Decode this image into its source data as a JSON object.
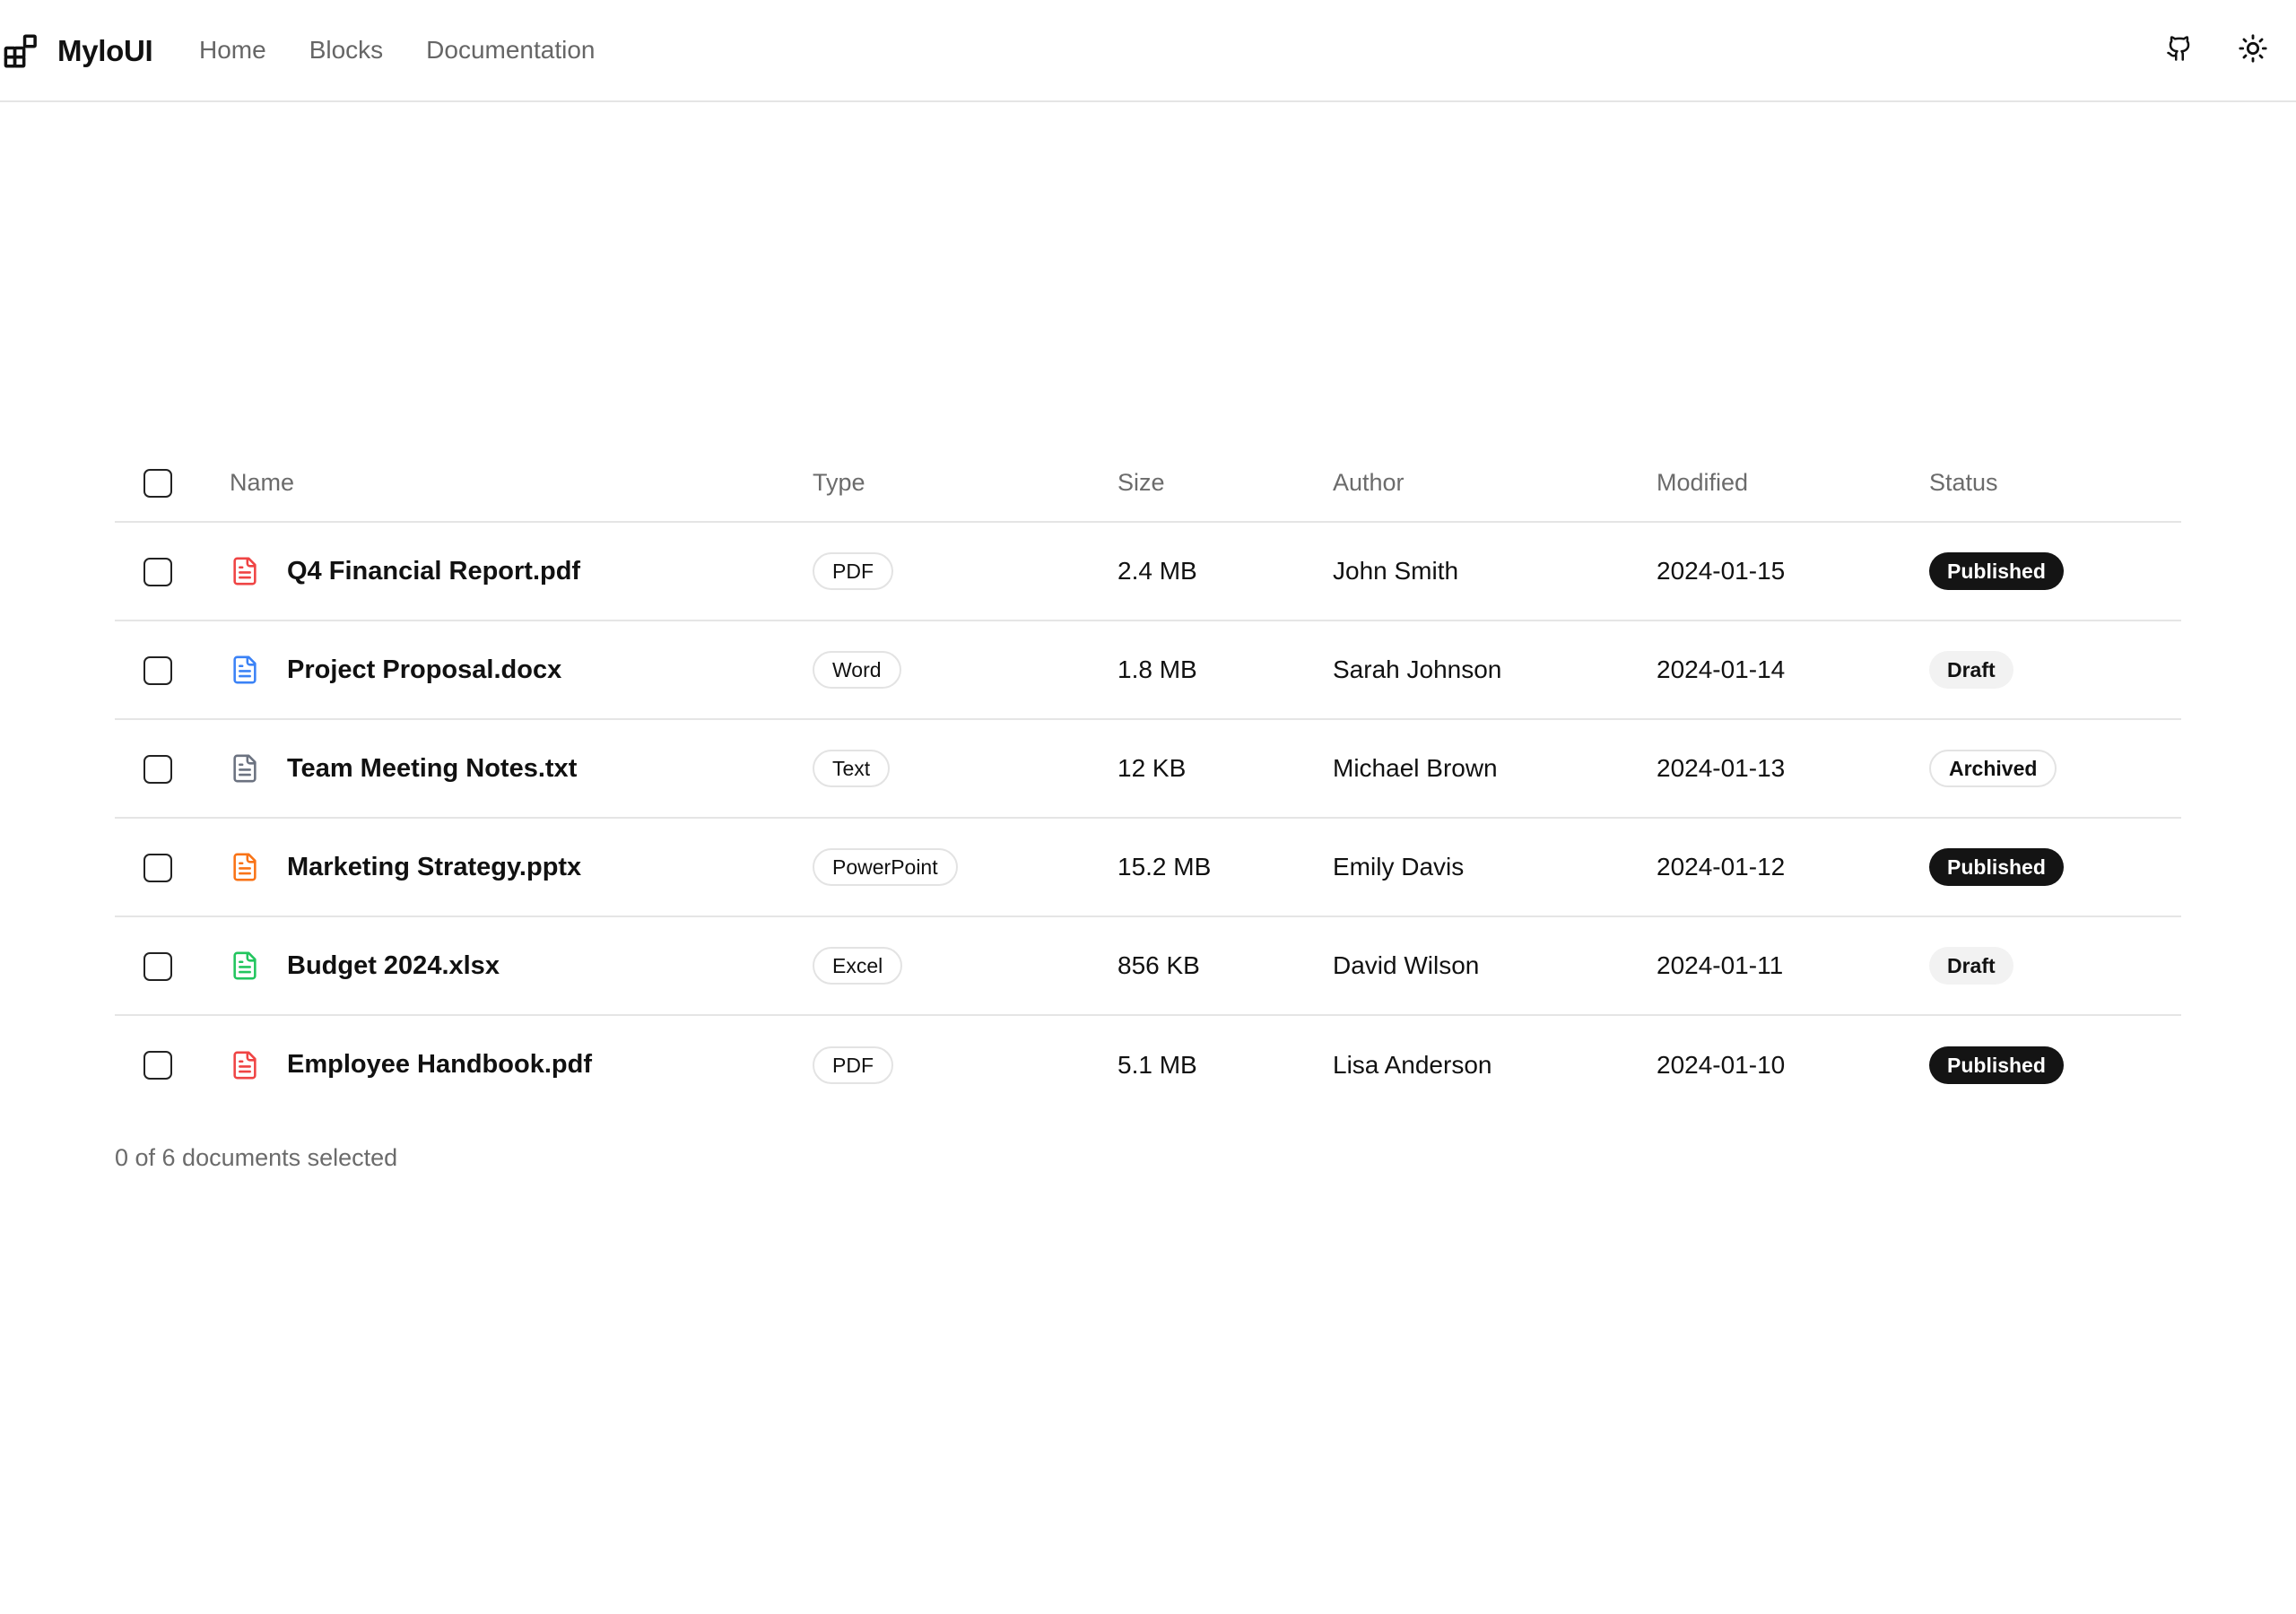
{
  "header": {
    "brand": "MyloUI",
    "nav": [
      {
        "label": "Home"
      },
      {
        "label": "Blocks"
      },
      {
        "label": "Documentation"
      }
    ],
    "icons": [
      "github-icon",
      "sun-icon"
    ]
  },
  "table": {
    "columns": [
      "Name",
      "Type",
      "Size",
      "Author",
      "Modified",
      "Status"
    ],
    "rows": [
      {
        "name": "Q4 Financial Report.pdf",
        "type": "PDF",
        "size": "2.4 MB",
        "author": "John Smith",
        "modified": "2024-01-15",
        "status": "Published",
        "icon_color": "#ef4444"
      },
      {
        "name": "Project Proposal.docx",
        "type": "Word",
        "size": "1.8 MB",
        "author": "Sarah Johnson",
        "modified": "2024-01-14",
        "status": "Draft",
        "icon_color": "#3b82f6"
      },
      {
        "name": "Team Meeting Notes.txt",
        "type": "Text",
        "size": "12 KB",
        "author": "Michael Brown",
        "modified": "2024-01-13",
        "status": "Archived",
        "icon_color": "#6b7280"
      },
      {
        "name": "Marketing Strategy.pptx",
        "type": "PowerPoint",
        "size": "15.2 MB",
        "author": "Emily Davis",
        "modified": "2024-01-12",
        "status": "Published",
        "icon_color": "#f97316"
      },
      {
        "name": "Budget 2024.xlsx",
        "type": "Excel",
        "size": "856 KB",
        "author": "David Wilson",
        "modified": "2024-01-11",
        "status": "Draft",
        "icon_color": "#22c55e"
      },
      {
        "name": "Employee Handbook.pdf",
        "type": "PDF",
        "size": "5.1 MB",
        "author": "Lisa Anderson",
        "modified": "2024-01-10",
        "status": "Published",
        "icon_color": "#ef4444"
      }
    ]
  },
  "footer": {
    "selection_text": "0 of 6 documents selected"
  }
}
